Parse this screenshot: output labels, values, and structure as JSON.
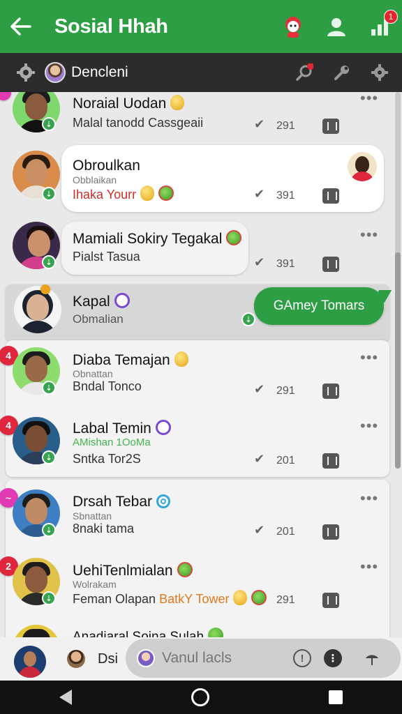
{
  "appbar": {
    "title": "Sosial Hhah",
    "notif_count": "1"
  },
  "subbar": {
    "channel": "Dencleni"
  },
  "chats": [
    {
      "name": "Noraial Uodan",
      "preview": "Malal tanodd Cassgeaii",
      "count": "291",
      "badge": ""
    },
    {
      "name": "Obroulkan",
      "sub": "Obblaikan",
      "preview": "Ihaka Yourr",
      "count": "391"
    },
    {
      "name": "Mamiali Sokiry Tegakal",
      "preview": "Pialst Tasua",
      "count": "391"
    },
    {
      "name": "Kapal",
      "preview": "Obmalian",
      "bubble": "GAmey Tomars"
    },
    {
      "name": "Diaba Temajan",
      "sub": "Obnattan",
      "preview": "Bndal Tonco",
      "count": "291",
      "badge": "4"
    },
    {
      "name": "Labal Temin",
      "sub": "AMishan 1OoMa",
      "preview": "Sntka Tor2S",
      "count": "201",
      "badge": "4"
    },
    {
      "name": "Drsah Tebar",
      "sub": "Sbnattan",
      "preview": "8naki tama",
      "count": "201",
      "badge": "~"
    },
    {
      "name": "UehiTenlmialan",
      "sub": "Wolrakam",
      "preview": "Feman Olapan",
      "preview_highlight": "BatkY Tower",
      "count": "291",
      "badge": "2"
    },
    {
      "name": "Anadiaral Soina Sulah"
    }
  ],
  "composer": {
    "short": "Dsi",
    "placeholder": "Vanul lacls"
  },
  "colors": {
    "primary": "#2e9e44",
    "dark_bar": "#2c2c2c",
    "badge_red": "#e0263d"
  }
}
